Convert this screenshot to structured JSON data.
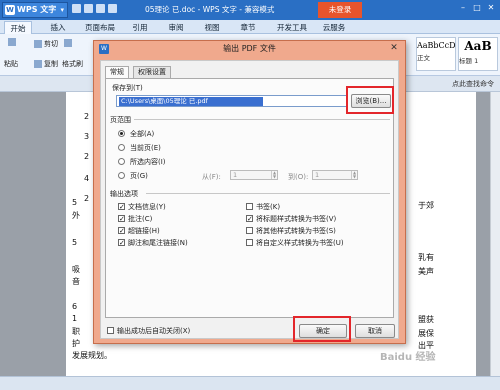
{
  "titlebar": {
    "app_name": "WPS 文字",
    "doc_title": "05理论 已.doc - WPS 文字 - 兼容模式",
    "login": "未登录"
  },
  "menu": [
    "开始",
    "插入",
    "页面布局",
    "引用",
    "审阅",
    "视图",
    "章节",
    "开发工具",
    "云服务"
  ],
  "ribbon": {
    "paste": "粘贴",
    "cut": "剪切",
    "copy": "复制",
    "format_painter": "格式刷",
    "style_normal_preview": "AaBbCcD",
    "style_normal_label": "正文",
    "style_h1_preview": "AaB",
    "style_h1_label": "标题 1"
  },
  "tabstrip": {
    "right_text": "点此查找命令"
  },
  "document": {
    "left_fragments": [
      "2",
      "3",
      "2",
      "4",
      "2",
      "5",
      "外",
      "5",
      "吸",
      "音",
      "6",
      "1",
      "职",
      "护",
      "发展规划。"
    ],
    "right_fragments": [
      "于郊",
      "乳有",
      "美声",
      "盟获",
      "展保",
      "出平"
    ]
  },
  "dialog": {
    "title": "输出 PDF 文件",
    "tabs": [
      "常规",
      "权限设置"
    ],
    "save_to_label": "保存到(T)",
    "save_path": "C:\\Users\\桌面\\05理论 已.pdf",
    "browse_button": "浏览(B)...",
    "page_range_label": "页范围",
    "range_options": [
      "全部(A)",
      "当前页(E)",
      "所选内容(I)",
      "页(G)"
    ],
    "selected_range": "全部(A)",
    "from_label": "从(F):",
    "from_value": "1",
    "to_label": "到(O):",
    "to_value": "1",
    "output_options_label": "输出选项",
    "left_options": [
      {
        "label": "文档信息(Y)",
        "checked": true
      },
      {
        "label": "批注(C)",
        "checked": true
      },
      {
        "label": "超链接(H)",
        "checked": true
      },
      {
        "label": "脚注和尾注链接(N)",
        "checked": true
      }
    ],
    "right_options": [
      {
        "label": "书签(K)",
        "checked": false
      },
      {
        "label": "将标题样式转换为书签(V)",
        "checked": true
      },
      {
        "label": "将其他样式转换为书签(S)",
        "checked": false
      },
      {
        "label": "将自定义样式转换为书签(U)",
        "checked": false
      }
    ],
    "auto_close_label": "输出成功后自动关闭(X)",
    "ok_button": "确定",
    "cancel_button": "取消"
  },
  "watermark": "Baidu 经验",
  "colors": {
    "dialog_frame": "#f0a98d",
    "highlight": "#e3262b",
    "titlebar": "#2a6fc4",
    "login": "#e8542c"
  }
}
